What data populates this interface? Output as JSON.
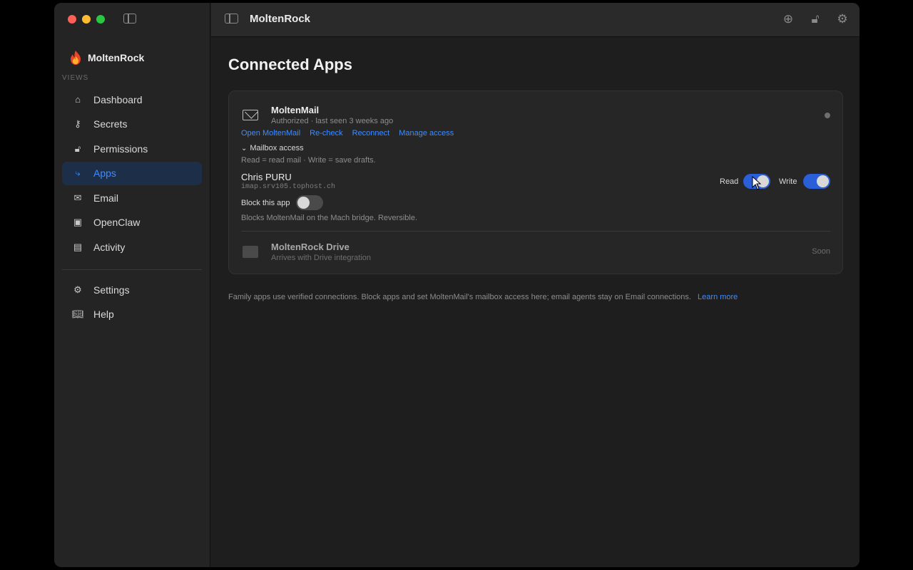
{
  "sidebar": {
    "brand": "MoltenRock",
    "section_label": "VIEWS",
    "items": [
      {
        "label": "Dashboard",
        "icon": "house-icon"
      },
      {
        "label": "Secrets",
        "icon": "key-icon"
      },
      {
        "label": "Permissions",
        "icon": "unlock-icon"
      },
      {
        "label": "Apps",
        "icon": "graph-icon",
        "active": true
      },
      {
        "label": "Email",
        "icon": "envelope-icon"
      },
      {
        "label": "OpenClaw",
        "icon": "chip-icon"
      },
      {
        "label": "Activity",
        "icon": "clipboard-icon"
      }
    ],
    "footer_items": [
      {
        "label": "Settings",
        "icon": "gear-icon"
      },
      {
        "label": "Help",
        "icon": "book-icon"
      }
    ]
  },
  "toolbar": {
    "title": "MoltenRock"
  },
  "main": {
    "title": "Connected Apps",
    "app": {
      "name": "MoltenMail",
      "status": "Authorized · last seen 3 weeks ago",
      "links": [
        "Open MoltenMail",
        "Re-check",
        "Reconnect",
        "Manage access"
      ],
      "disclosure_label": "Mailbox access",
      "disclosure_desc": "Read = read mail · Write = save drafts.",
      "account_name": "Chris PURU",
      "account_host": "imap.srv105.tophost.ch",
      "read_label": "Read",
      "read_on": true,
      "write_label": "Write",
      "write_on": true,
      "block_label": "Block this app",
      "block_on": false,
      "block_desc": "Blocks MoltenMail on the Mach bridge. Reversible."
    },
    "drive": {
      "name": "MoltenRock Drive",
      "sub": "Arrives with Drive integration",
      "status": "Soon"
    },
    "footer_note": "Family apps use verified connections. Block apps and set MoltenMail's mailbox access here; email agents stay on Email connections.",
    "footer_link": "Learn more"
  },
  "colors": {
    "accent": "#3f8cff",
    "toggle_on": "#2a5fd8",
    "active_bg": "#1d2e48"
  }
}
